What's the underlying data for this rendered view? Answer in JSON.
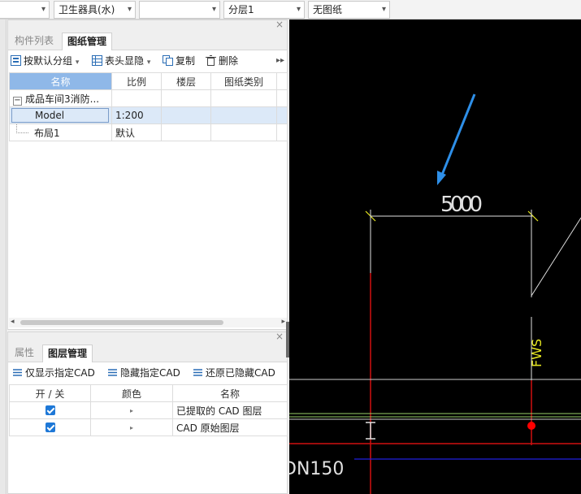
{
  "toolbar": {
    "dropdowns": [
      {
        "value": ""
      },
      {
        "value": "卫生器具(水)"
      },
      {
        "value": ""
      },
      {
        "value": "分层1"
      },
      {
        "value": "无图纸"
      }
    ]
  },
  "drawing_panel": {
    "tabs": [
      "构件列表",
      "图纸管理"
    ],
    "active_tab": "图纸管理",
    "tools": {
      "group": "按默认分组",
      "header_display": "表头显隐",
      "copy": "复制",
      "delete": "删除"
    },
    "columns": [
      "名称",
      "比例",
      "楼层",
      "图纸类别"
    ],
    "rows": [
      {
        "name": "成品车间3消防...",
        "scale": "",
        "floor": "",
        "category": ""
      },
      {
        "name": "Model",
        "scale": "1:200",
        "floor": "",
        "category": ""
      },
      {
        "name": "布局1",
        "scale": "默认",
        "floor": "",
        "category": ""
      }
    ]
  },
  "layer_panel": {
    "tabs": [
      "属性",
      "图层管理"
    ],
    "active_tab": "图层管理",
    "tools": {
      "show_only": "仅显示指定CAD",
      "hide": "隐藏指定CAD",
      "restore": "还原已隐藏CAD"
    },
    "columns": [
      "开 / 关",
      "颜色",
      "名称"
    ],
    "rows": [
      {
        "on": true,
        "name": "已提取的 CAD 图层"
      },
      {
        "on": true,
        "name": "CAD 原始图层"
      }
    ]
  },
  "cad": {
    "dimension_text": "5000",
    "pipe_label": "FWS",
    "pipe_size_text": "DN150",
    "arrow_color": "#2e8fe8",
    "pipe_color": "#d01010",
    "marker_color": "#ff0000"
  }
}
